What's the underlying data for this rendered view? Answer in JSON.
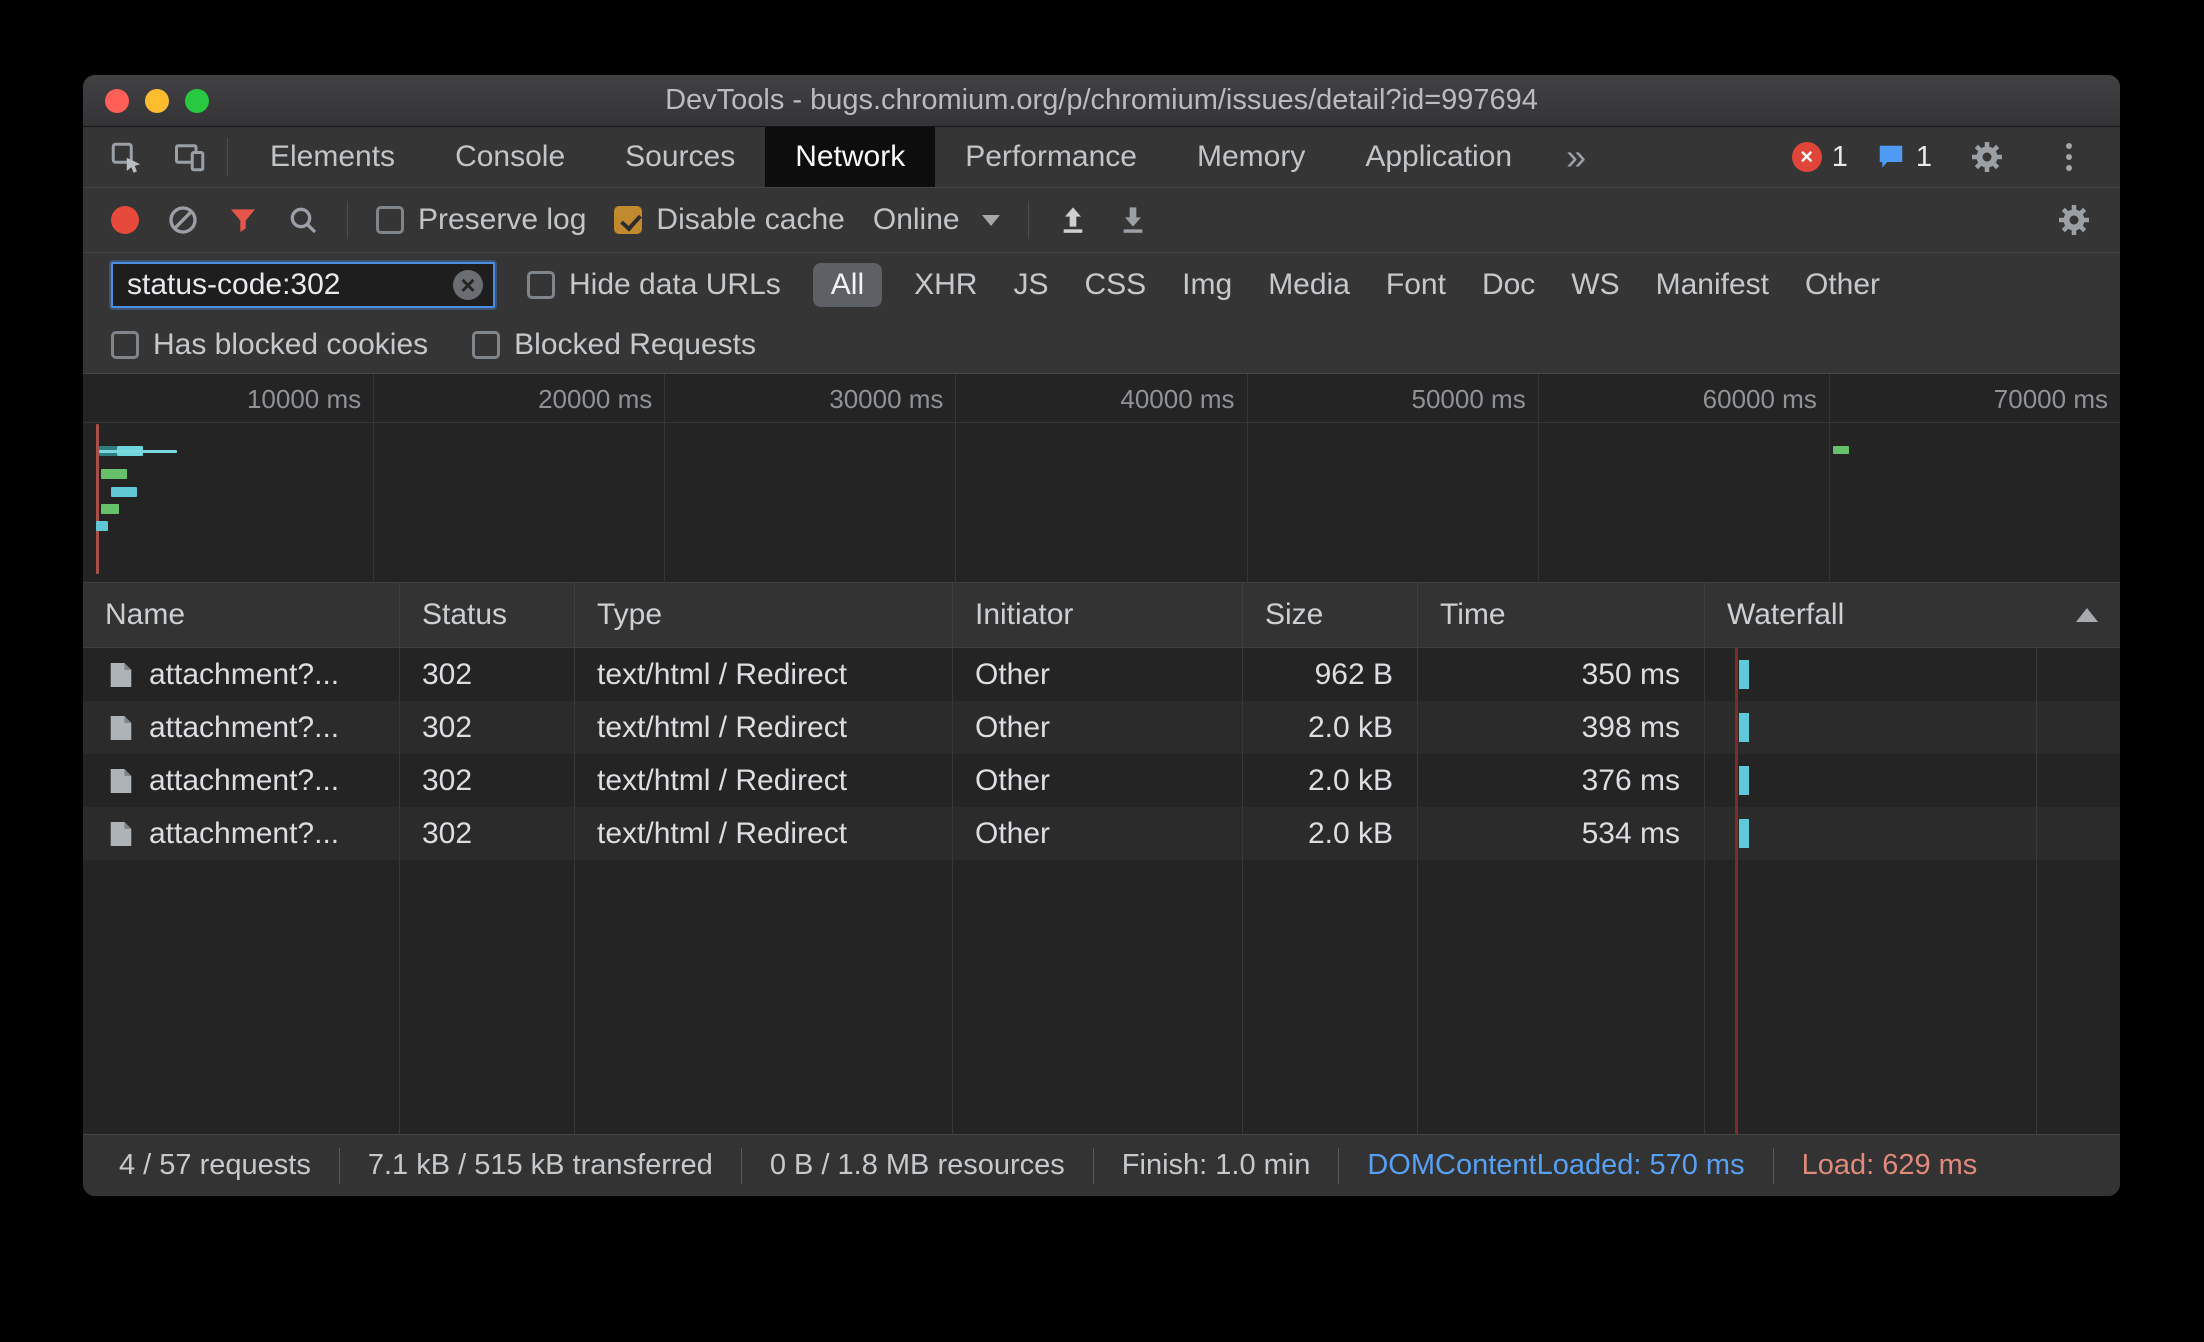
{
  "window": {
    "title": "DevTools - bugs.chromium.org/p/chromium/issues/detail?id=997694"
  },
  "tabs": {
    "items": [
      {
        "label": "Elements"
      },
      {
        "label": "Console"
      },
      {
        "label": "Sources"
      },
      {
        "label": "Network"
      },
      {
        "label": "Performance"
      },
      {
        "label": "Memory"
      },
      {
        "label": "Application"
      }
    ],
    "overflow": "»",
    "error_count": "1",
    "message_count": "1"
  },
  "toolbar": {
    "preserve_log_label": "Preserve log",
    "disable_cache_label": "Disable cache",
    "throttling_value": "Online"
  },
  "filters": {
    "query": "status-code:302",
    "hide_data_urls_label": "Hide data URLs",
    "all_label": "All",
    "types": [
      "XHR",
      "JS",
      "CSS",
      "Img",
      "Media",
      "Font",
      "Doc",
      "WS",
      "Manifest",
      "Other"
    ],
    "has_blocked_cookies_label": "Has blocked cookies",
    "blocked_requests_label": "Blocked Requests"
  },
  "overview": {
    "ticks": [
      "10000 ms",
      "20000 ms",
      "30000 ms",
      "40000 ms",
      "50000 ms",
      "60000 ms",
      "70000 ms"
    ]
  },
  "table": {
    "columns": {
      "name": "Name",
      "status": "Status",
      "type": "Type",
      "initiator": "Initiator",
      "size": "Size",
      "time": "Time",
      "waterfall": "Waterfall"
    },
    "rows": [
      {
        "name": "attachment?...",
        "status": "302",
        "type": "text/html / Redirect",
        "initiator": "Other",
        "size": "962 B",
        "time": "350 ms"
      },
      {
        "name": "attachment?...",
        "status": "302",
        "type": "text/html / Redirect",
        "initiator": "Other",
        "size": "2.0 kB",
        "time": "398 ms"
      },
      {
        "name": "attachment?...",
        "status": "302",
        "type": "text/html / Redirect",
        "initiator": "Other",
        "size": "2.0 kB",
        "time": "376 ms"
      },
      {
        "name": "attachment?...",
        "status": "302",
        "type": "text/html / Redirect",
        "initiator": "Other",
        "size": "2.0 kB",
        "time": "534 ms"
      }
    ]
  },
  "statusbar": {
    "requests": "4 / 57 requests",
    "transferred": "7.1 kB / 515 kB transferred",
    "resources": "0 B / 1.8 MB resources",
    "finish": "Finish: 1.0 min",
    "dcl": "DOMContentLoaded: 570 ms",
    "load": "Load: 629 ms"
  },
  "colors": {
    "accent_blue": "#4a8fe2",
    "record_red": "#e8493d",
    "filter_red": "#e5554a",
    "cache_checkbox_orange": "#c18a2e",
    "waterfall_teal": "#5ec9d8",
    "load_line_red": "#7e2c26",
    "dcl_text_blue": "#58a0f2",
    "load_text_red": "#e0897d"
  }
}
